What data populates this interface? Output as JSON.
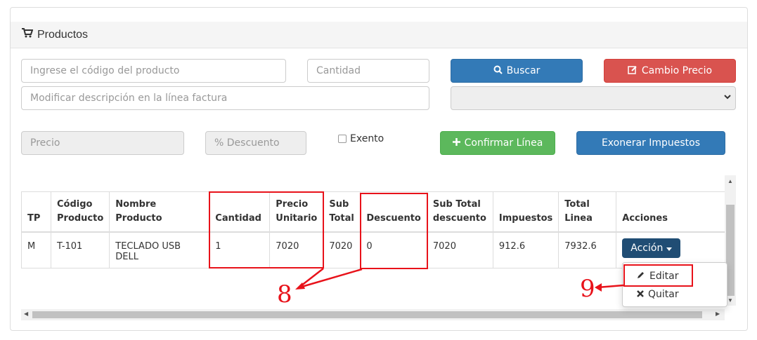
{
  "panel": {
    "title": "Productos",
    "icon": "cart-icon"
  },
  "form": {
    "product_code_placeholder": "Ingrese el código del producto",
    "quantity_placeholder": "Cantidad",
    "description_placeholder": "Modificar descripción en la línea factura",
    "price_placeholder": "Precio",
    "discount_placeholder": "% Descuento",
    "exento_label": "Exento",
    "search_button": "Buscar",
    "change_price_button": "Cambio Precio",
    "confirm_line_button": "Confirmar Línea",
    "exonerate_button": "Exonerar Impuestos"
  },
  "table": {
    "headers": [
      "TP",
      "Código Producto",
      "Nombre Producto",
      "Cantidad",
      "Precio Unitario",
      "Sub Total",
      "Descuento",
      "Sub Total descuento",
      "Impuestos",
      "Total Linea",
      "Acciones"
    ],
    "rows": [
      {
        "tp": "M",
        "code": "T-101",
        "name": "TECLADO USB DELL",
        "quantity": "1",
        "unit_price": "7020",
        "subtotal": "7020",
        "discount": "0",
        "subtotal_discount": "7020",
        "taxes": "912.6",
        "total": "7932.6",
        "action_label": "Acción"
      }
    ]
  },
  "action_menu": {
    "edit": "Editar",
    "remove": "Quitar"
  },
  "annotations": {
    "callout_8": "8",
    "callout_9": "9",
    "color": "#e8121a"
  }
}
